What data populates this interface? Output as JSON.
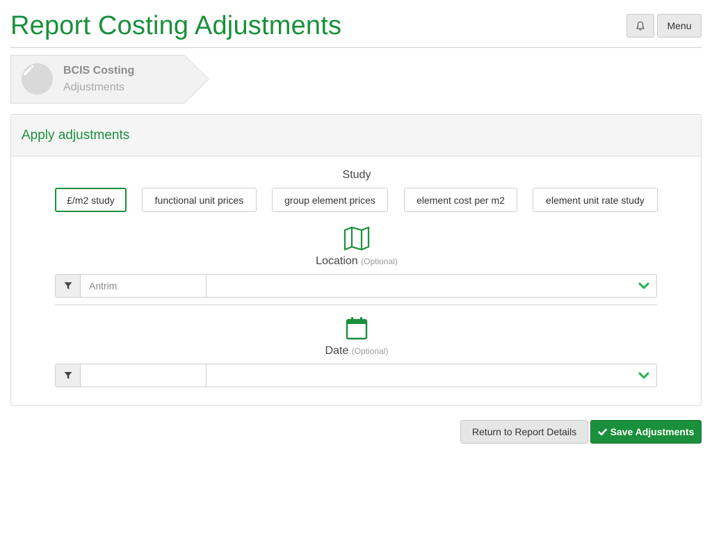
{
  "page": {
    "title": "Report Costing Adjustments"
  },
  "header": {
    "bell_icon": "bell-icon",
    "menu_label": "Menu"
  },
  "wizard": {
    "step_title": "BCIS Costing",
    "step_subtitle": "Adjustments",
    "step_icon": "pencil-icon"
  },
  "panel": {
    "heading": "Apply adjustments",
    "study": {
      "label": "Study",
      "options": [
        "£/m2 study",
        "functional unit prices",
        "group element prices",
        "element cost per m2",
        "element unit rate study"
      ],
      "selected": "£/m2 study"
    },
    "location": {
      "icon": "map-icon",
      "label": "Location",
      "optional": "(Optional)",
      "filter_placeholder": "Antrim",
      "selected_value": ""
    },
    "date": {
      "icon": "calendar-icon",
      "label": "Date",
      "optional": "(Optional)",
      "filter_placeholder": "",
      "selected_value": ""
    }
  },
  "actions": {
    "return_label": "Return to Report Details",
    "save_label": "Save Adjustments"
  },
  "colors": {
    "brand_green": "#1a8f3c",
    "chevron_green": "#22b34a"
  }
}
